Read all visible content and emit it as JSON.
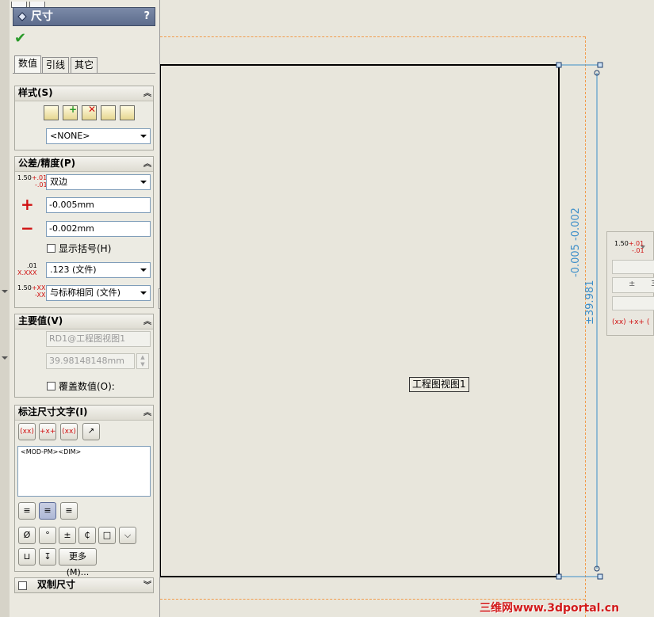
{
  "panel": {
    "title": "尺寸",
    "help": "?",
    "ok_icon": "✔",
    "tabs": [
      "数值",
      "引线",
      "其它"
    ],
    "style_group": {
      "title": "样式(S)",
      "select_value": "<NONE>"
    },
    "tolerance_group": {
      "title": "公差/精度(P)",
      "type_value": "双边",
      "plus_value": "-0.005mm",
      "minus_value": "-0.002mm",
      "show_parentheses_label": "显示括号(H)",
      "precision_value": ".123 (文件)",
      "tol_precision_value": "与标称相同 (文件)",
      "icon_text": {
        "base": "1.50",
        "plus": "+.01",
        "minus": "-.01",
        "xx_plus": "+XX",
        "xx_minus": "-XX",
        "grid": "X.XXX",
        "grid_top": ".01"
      }
    },
    "primary_value_group": {
      "title": "主要值(V)",
      "name_value": "RD1@工程图视图1",
      "numeric_value": "39.98148148mm",
      "override_label": "覆盖数值(O):"
    },
    "dim_text_group": {
      "title": "标注尺寸文字(I)",
      "text_value": "<MOD-PM><DIM>",
      "symbol_buttons": [
        "Ø",
        "°",
        "±",
        "₵",
        "□",
        "⌵",
        "⊔",
        "↧"
      ],
      "more_label": "更多(M)..."
    },
    "dual_group": {
      "title": "双制尺寸"
    }
  },
  "drawing": {
    "view_label": "工程图视图1",
    "dim_tolerance_text": "-0.005  -0.002",
    "dim_value_text": "±39.981"
  },
  "popup": {
    "base": "1.50",
    "plus": "+.01",
    "minus": "-.01",
    "pm": "±",
    "digit": "3",
    "paren": "(xx)",
    "arrows": "+x+",
    "paren2": "("
  },
  "watermark": "三维网www.3dportal.cn",
  "colors": {
    "titlebar": "#6a7a9a",
    "ok": "#2a9a2a",
    "dim_line": "#3c8ec9",
    "sheet_border": "#f29b4a",
    "red_symbol": "#d01010"
  }
}
